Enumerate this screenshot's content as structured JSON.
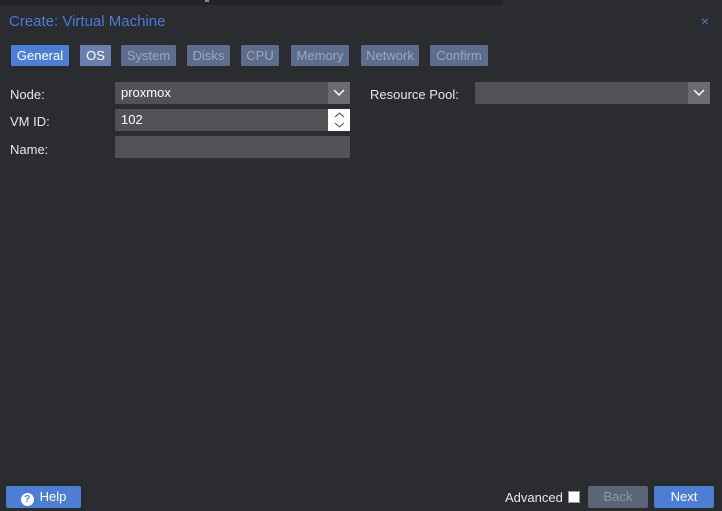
{
  "window": {
    "title": "Create: Virtual Machine",
    "close_glyph": "×"
  },
  "tabs": [
    {
      "label": "General",
      "state": "active"
    },
    {
      "label": "OS",
      "state": "enabled"
    },
    {
      "label": "System",
      "state": "disabled"
    },
    {
      "label": "Disks",
      "state": "disabled"
    },
    {
      "label": "CPU",
      "state": "disabled"
    },
    {
      "label": "Memory",
      "state": "disabled"
    },
    {
      "label": "Network",
      "state": "disabled"
    },
    {
      "label": "Confirm",
      "state": "disabled"
    }
  ],
  "form": {
    "node": {
      "label": "Node:",
      "value": "proxmox"
    },
    "vmid": {
      "label": "VM ID:",
      "value": "102"
    },
    "name": {
      "label": "Name:",
      "value": ""
    },
    "resource_pool": {
      "label": "Resource Pool:",
      "value": ""
    }
  },
  "footer": {
    "help_label": "Help",
    "advanced_label": "Advanced",
    "advanced_checked": false,
    "back_label": "Back",
    "next_label": "Next"
  },
  "colors": {
    "accent": "#4d7ed4",
    "title": "#4c7ad6",
    "background": "#2a2c30",
    "field": "#505256"
  },
  "icons": {
    "close": "close-icon",
    "dropdown": "chevron-down-icon",
    "spinner": "spinner-arrows-icon",
    "help": "question-circle-icon"
  }
}
